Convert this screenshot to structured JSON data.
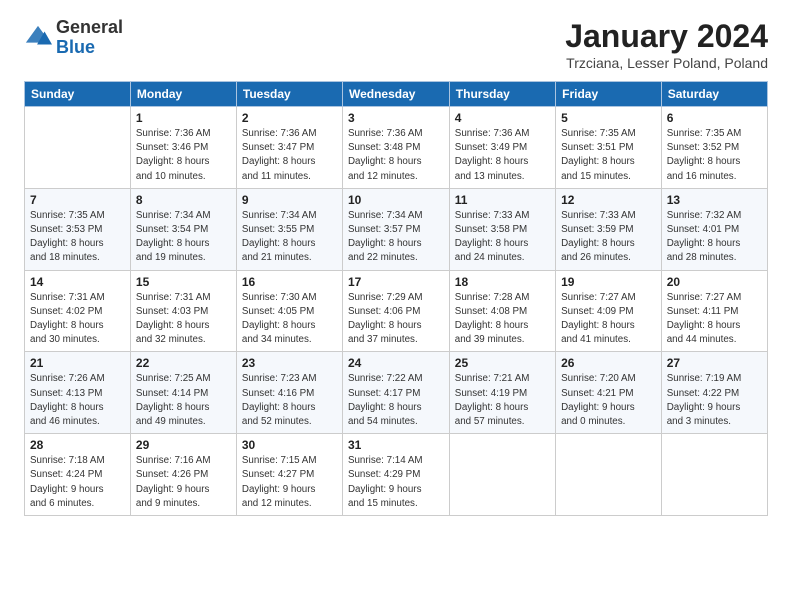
{
  "header": {
    "logo_general": "General",
    "logo_blue": "Blue",
    "title": "January 2024",
    "location": "Trzciana, Lesser Poland, Poland"
  },
  "days_of_week": [
    "Sunday",
    "Monday",
    "Tuesday",
    "Wednesday",
    "Thursday",
    "Friday",
    "Saturday"
  ],
  "weeks": [
    [
      {
        "day": null,
        "info": null
      },
      {
        "day": "1",
        "info": "Sunrise: 7:36 AM\nSunset: 3:46 PM\nDaylight: 8 hours\nand 10 minutes."
      },
      {
        "day": "2",
        "info": "Sunrise: 7:36 AM\nSunset: 3:47 PM\nDaylight: 8 hours\nand 11 minutes."
      },
      {
        "day": "3",
        "info": "Sunrise: 7:36 AM\nSunset: 3:48 PM\nDaylight: 8 hours\nand 12 minutes."
      },
      {
        "day": "4",
        "info": "Sunrise: 7:36 AM\nSunset: 3:49 PM\nDaylight: 8 hours\nand 13 minutes."
      },
      {
        "day": "5",
        "info": "Sunrise: 7:35 AM\nSunset: 3:51 PM\nDaylight: 8 hours\nand 15 minutes."
      },
      {
        "day": "6",
        "info": "Sunrise: 7:35 AM\nSunset: 3:52 PM\nDaylight: 8 hours\nand 16 minutes."
      }
    ],
    [
      {
        "day": "7",
        "info": "Sunrise: 7:35 AM\nSunset: 3:53 PM\nDaylight: 8 hours\nand 18 minutes."
      },
      {
        "day": "8",
        "info": "Sunrise: 7:34 AM\nSunset: 3:54 PM\nDaylight: 8 hours\nand 19 minutes."
      },
      {
        "day": "9",
        "info": "Sunrise: 7:34 AM\nSunset: 3:55 PM\nDaylight: 8 hours\nand 21 minutes."
      },
      {
        "day": "10",
        "info": "Sunrise: 7:34 AM\nSunset: 3:57 PM\nDaylight: 8 hours\nand 22 minutes."
      },
      {
        "day": "11",
        "info": "Sunrise: 7:33 AM\nSunset: 3:58 PM\nDaylight: 8 hours\nand 24 minutes."
      },
      {
        "day": "12",
        "info": "Sunrise: 7:33 AM\nSunset: 3:59 PM\nDaylight: 8 hours\nand 26 minutes."
      },
      {
        "day": "13",
        "info": "Sunrise: 7:32 AM\nSunset: 4:01 PM\nDaylight: 8 hours\nand 28 minutes."
      }
    ],
    [
      {
        "day": "14",
        "info": "Sunrise: 7:31 AM\nSunset: 4:02 PM\nDaylight: 8 hours\nand 30 minutes."
      },
      {
        "day": "15",
        "info": "Sunrise: 7:31 AM\nSunset: 4:03 PM\nDaylight: 8 hours\nand 32 minutes."
      },
      {
        "day": "16",
        "info": "Sunrise: 7:30 AM\nSunset: 4:05 PM\nDaylight: 8 hours\nand 34 minutes."
      },
      {
        "day": "17",
        "info": "Sunrise: 7:29 AM\nSunset: 4:06 PM\nDaylight: 8 hours\nand 37 minutes."
      },
      {
        "day": "18",
        "info": "Sunrise: 7:28 AM\nSunset: 4:08 PM\nDaylight: 8 hours\nand 39 minutes."
      },
      {
        "day": "19",
        "info": "Sunrise: 7:27 AM\nSunset: 4:09 PM\nDaylight: 8 hours\nand 41 minutes."
      },
      {
        "day": "20",
        "info": "Sunrise: 7:27 AM\nSunset: 4:11 PM\nDaylight: 8 hours\nand 44 minutes."
      }
    ],
    [
      {
        "day": "21",
        "info": "Sunrise: 7:26 AM\nSunset: 4:13 PM\nDaylight: 8 hours\nand 46 minutes."
      },
      {
        "day": "22",
        "info": "Sunrise: 7:25 AM\nSunset: 4:14 PM\nDaylight: 8 hours\nand 49 minutes."
      },
      {
        "day": "23",
        "info": "Sunrise: 7:23 AM\nSunset: 4:16 PM\nDaylight: 8 hours\nand 52 minutes."
      },
      {
        "day": "24",
        "info": "Sunrise: 7:22 AM\nSunset: 4:17 PM\nDaylight: 8 hours\nand 54 minutes."
      },
      {
        "day": "25",
        "info": "Sunrise: 7:21 AM\nSunset: 4:19 PM\nDaylight: 8 hours\nand 57 minutes."
      },
      {
        "day": "26",
        "info": "Sunrise: 7:20 AM\nSunset: 4:21 PM\nDaylight: 9 hours\nand 0 minutes."
      },
      {
        "day": "27",
        "info": "Sunrise: 7:19 AM\nSunset: 4:22 PM\nDaylight: 9 hours\nand 3 minutes."
      }
    ],
    [
      {
        "day": "28",
        "info": "Sunrise: 7:18 AM\nSunset: 4:24 PM\nDaylight: 9 hours\nand 6 minutes."
      },
      {
        "day": "29",
        "info": "Sunrise: 7:16 AM\nSunset: 4:26 PM\nDaylight: 9 hours\nand 9 minutes."
      },
      {
        "day": "30",
        "info": "Sunrise: 7:15 AM\nSunset: 4:27 PM\nDaylight: 9 hours\nand 12 minutes."
      },
      {
        "day": "31",
        "info": "Sunrise: 7:14 AM\nSunset: 4:29 PM\nDaylight: 9 hours\nand 15 minutes."
      },
      {
        "day": null,
        "info": null
      },
      {
        "day": null,
        "info": null
      },
      {
        "day": null,
        "info": null
      }
    ]
  ]
}
